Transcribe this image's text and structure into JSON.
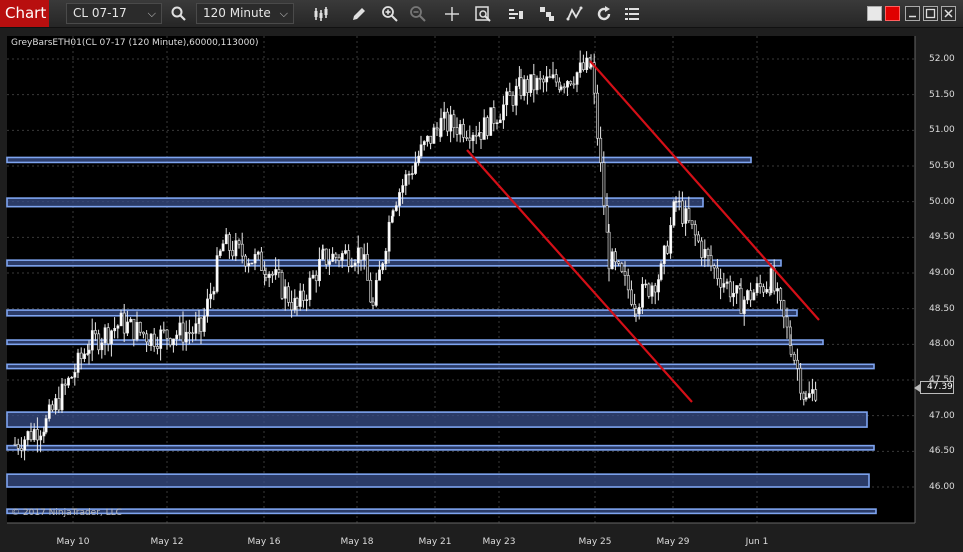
{
  "toolbar": {
    "tab_label": "Chart",
    "instrument": "CL 07-17",
    "interval": "120 Minute",
    "icons": [
      "search-icon",
      "bar-style-icon",
      "pencil-icon",
      "zoom-in-icon",
      "zoom-out-icon",
      "crosshair-icon",
      "data-box-icon",
      "indicators-icon",
      "strategies-icon",
      "drawing-tools-icon",
      "refresh-icon",
      "properties-icon"
    ]
  },
  "chart": {
    "title": "GreyBarsETH01(CL 07-17 (120 Minute),60000,113000)",
    "copyright": "© 2017 NinjaTrader, LLC",
    "last_price": "47.39",
    "price_labels": [
      "52.00",
      "51.50",
      "51.00",
      "50.50",
      "50.00",
      "49.50",
      "49.00",
      "48.50",
      "48.00",
      "47.50",
      "47.00",
      "46.50",
      "46.00"
    ],
    "date_labels": [
      "May 10",
      "May 12",
      "May 16",
      "May 18",
      "May 21",
      "May 23",
      "May 25",
      "May 29",
      "Jun 1"
    ],
    "colors": {
      "background": "#000000",
      "zone_fill": "#3a4f8a",
      "zone_border": "#7ea4f0",
      "trendline": "#d40f17",
      "candle": "#e8e8e8"
    }
  },
  "chart_data": {
    "type": "candlestick",
    "title": "GreyBarsETH01(CL 07-17 (120 Minute),60000,113000)",
    "y_axis_ticks": [
      52.0,
      51.5,
      51.0,
      50.5,
      50.0,
      49.5,
      49.0,
      48.5,
      48.0,
      47.5,
      47.0,
      46.5,
      46.0
    ],
    "ylim": [
      45.7,
      52.2
    ],
    "x_tick_labels": [
      "May 10",
      "May 12",
      "May 16",
      "May 18",
      "May 21",
      "May 23",
      "May 25",
      "May 29",
      "Jun 1"
    ],
    "last_price": 47.39,
    "close_path": [
      {
        "date": "May 10",
        "close": 46.6
      },
      {
        "date": "May 10",
        "close": 46.9
      },
      {
        "date": "May 10",
        "close": 48.0
      },
      {
        "date": "May 12",
        "close": 48.3
      },
      {
        "date": "May 12",
        "close": 48.1
      },
      {
        "date": "May 12",
        "close": 48.2
      },
      {
        "date": "May 16",
        "close": 49.4
      },
      {
        "date": "May 16",
        "close": 49.1
      },
      {
        "date": "May 16",
        "close": 48.5
      },
      {
        "date": "May 18",
        "close": 49.2
      },
      {
        "date": "May 18",
        "close": 49.3
      },
      {
        "date": "May 18",
        "close": 48.5
      },
      {
        "date": "May 21",
        "close": 50.0
      },
      {
        "date": "May 21",
        "close": 50.7
      },
      {
        "date": "May 21",
        "close": 51.1
      },
      {
        "date": "May 23",
        "close": 51.0
      },
      {
        "date": "May 23",
        "close": 51.6
      },
      {
        "date": "May 23",
        "close": 51.7
      },
      {
        "date": "May 25",
        "close": 51.9
      },
      {
        "date": "May 25",
        "close": 49.2
      },
      {
        "date": "May 25",
        "close": 48.6
      },
      {
        "date": "May 29",
        "close": 49.0
      },
      {
        "date": "May 29",
        "close": 50.0
      },
      {
        "date": "May 29",
        "close": 49.1
      },
      {
        "date": "Jun 1",
        "close": 48.6
      },
      {
        "date": "Jun 1",
        "close": 48.9
      },
      {
        "date": "Jun 1",
        "close": 48.0
      },
      {
        "date": "Jun 1",
        "close": 47.2
      },
      {
        "date": "Jun 1",
        "close": 47.39
      }
    ],
    "zones": [
      {
        "low": 50.55,
        "high": 50.62
      },
      {
        "low": 49.93,
        "high": 50.05
      },
      {
        "low": 49.1,
        "high": 49.18
      },
      {
        "low": 48.4,
        "high": 48.48
      },
      {
        "low": 48.0,
        "high": 48.06
      },
      {
        "low": 47.66,
        "high": 47.72
      },
      {
        "low": 46.84,
        "high": 47.05
      },
      {
        "low": 46.52,
        "high": 46.58
      },
      {
        "low": 46.0,
        "high": 46.18
      },
      {
        "low": 45.63,
        "high": 45.69
      }
    ],
    "trendlines": [
      {
        "from": {
          "date": "May 21",
          "price": 50.7
        },
        "to": {
          "date": "Jun 1",
          "price": 47.2
        }
      },
      {
        "from": {
          "date": "May 25",
          "price": 52.0
        },
        "to": {
          "date": "Jun 1",
          "price": 48.4
        }
      }
    ]
  }
}
